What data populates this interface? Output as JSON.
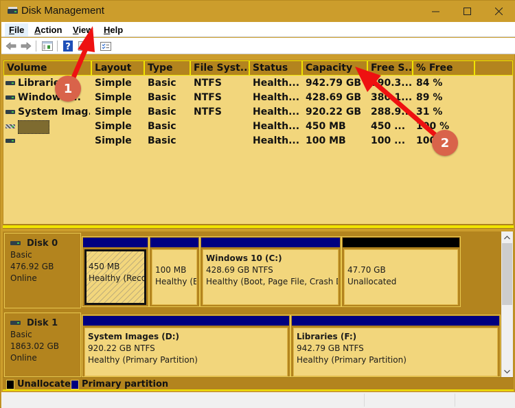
{
  "window": {
    "title": "Disk Management",
    "controls": {
      "minimize": "—",
      "maximize": "☐",
      "close": "✕"
    }
  },
  "menu": [
    {
      "label": "File",
      "accel": "F",
      "rest": "ile"
    },
    {
      "label": "Action",
      "accel": "A",
      "rest": "ction"
    },
    {
      "label": "View",
      "accel": "V",
      "rest": "iew"
    },
    {
      "label": "Help",
      "accel": "H",
      "rest": "elp"
    }
  ],
  "toolbar": {
    "buttons": [
      "back-icon",
      "forward-icon",
      "console-tree-icon",
      "help-icon",
      "properties-icon",
      "settings-list-icon"
    ]
  },
  "volume_list": {
    "columns": [
      "Volume",
      "Layout",
      "Type",
      "File Syst...",
      "Status",
      "Capacity",
      "Free S...",
      "% Free",
      ""
    ],
    "rows": [
      {
        "volume": "Libraries",
        "layout": "Simple",
        "type": "Basic",
        "fs": "NTFS",
        "status": "Health...",
        "capacity": "942.79 GB",
        "free": "890.3...",
        "pct": "84 %"
      },
      {
        "volume": "Windows ...",
        "layout": "Simple",
        "type": "Basic",
        "fs": "NTFS",
        "status": "Health...",
        "capacity": "428.69 GB",
        "free": "380.1...",
        "pct": "89 %"
      },
      {
        "volume": "System Imag...",
        "layout": "Simple",
        "type": "Basic",
        "fs": "NTFS",
        "status": "Health...",
        "capacity": "920.22 GB",
        "free": "288.9...",
        "pct": "31 %"
      },
      {
        "volume": "",
        "layout": "Simple",
        "type": "Basic",
        "fs": "",
        "status": "Health...",
        "capacity": "450 MB",
        "free": "450 ...",
        "pct": "100 %"
      },
      {
        "volume": "",
        "layout": "Simple",
        "type": "Basic",
        "fs": "",
        "status": "Health...",
        "capacity": "100 MB",
        "free": "100 ...",
        "pct": "100 %"
      }
    ]
  },
  "disks": [
    {
      "name": "Disk 0",
      "type": "Basic",
      "size": "476.92 GB",
      "state": "Online",
      "partitions": [
        {
          "title": "",
          "line1": "450 MB",
          "line2": "Healthy (Recovery Partition)",
          "bar": "#000080",
          "selected": true
        },
        {
          "title": "",
          "line1": "100 MB",
          "line2": "Healthy (EFI System Partition)",
          "bar": "#000080"
        },
        {
          "title": "Windows 10  (C:)",
          "line1": "428.69 GB NTFS",
          "line2": "Healthy (Boot, Page File, Crash Dump, Primary Partition)",
          "bar": "#000080"
        },
        {
          "title": "",
          "line1": "47.70 GB",
          "line2": "Unallocated",
          "bar": "#000000"
        }
      ]
    },
    {
      "name": "Disk 1",
      "type": "Basic",
      "size": "1863.02 GB",
      "state": "Online",
      "partitions": [
        {
          "title": "System Images  (D:)",
          "line1": "920.22 GB NTFS",
          "line2": "Healthy (Primary Partition)",
          "bar": "#000080"
        },
        {
          "title": "Libraries  (F:)",
          "line1": "942.79 GB NTFS",
          "line2": "Healthy (Primary Partition)",
          "bar": "#000080"
        }
      ]
    }
  ],
  "legend": [
    {
      "label": "Unallocated",
      "color": "#000000"
    },
    {
      "label": "Primary partition",
      "color": "#000080"
    }
  ],
  "annotations": [
    {
      "number": "1",
      "points_to": "View menu"
    },
    {
      "number": "2",
      "points_to": "Capacity column header"
    }
  ],
  "colors": {
    "titlebar": "#cc9d2c",
    "list_bg": "#f2d67c",
    "header_bg": "#b3841e",
    "header_border": "#f1e400",
    "primary": "#000080",
    "unallocated": "#000000",
    "arrow": "#ee1111",
    "badge": "#d9634a"
  }
}
